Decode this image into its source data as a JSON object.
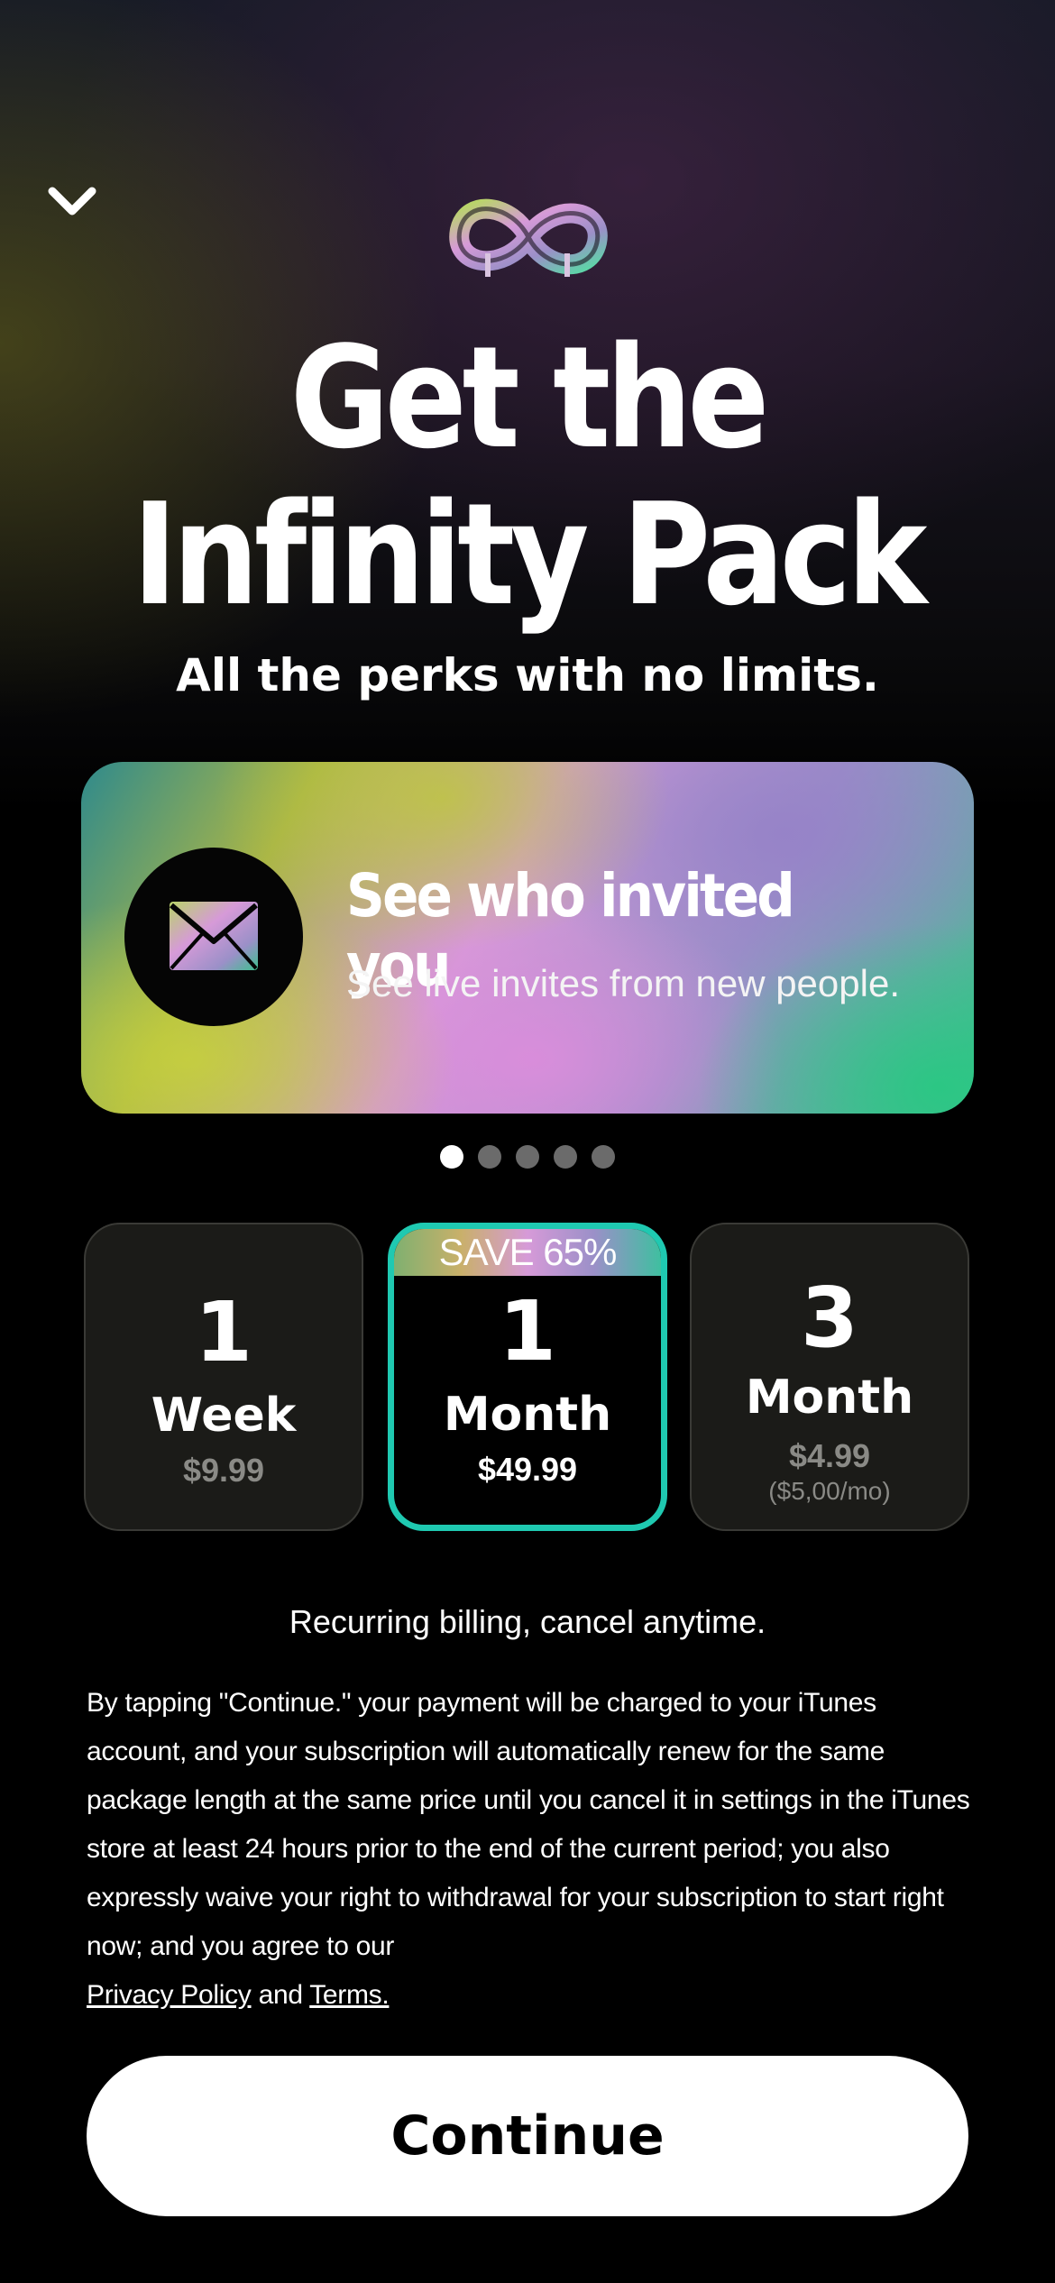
{
  "header": {
    "dismiss_icon": "chevron-down-icon",
    "logo_icon": "infinity-icon"
  },
  "hero": {
    "title_line1": "Get the",
    "title_line2": "Infinity Pack",
    "subtitle": "All the perks with no limits."
  },
  "feature_carousel": {
    "active_index": 0,
    "page_count": 5,
    "card": {
      "icon": "envelope-icon",
      "title": "See who invited you",
      "subtitle": "See live invites from new people."
    }
  },
  "plans": [
    {
      "number": "1",
      "unit": "Week",
      "price": "$9.99",
      "selected": false
    },
    {
      "badge": "SAVE 65%",
      "number": "1",
      "unit": "Month",
      "price": "$49.99",
      "selected": true
    },
    {
      "number": "3",
      "unit": "Month",
      "price": "$4.99",
      "per_month": "($5,00/mo)",
      "selected": false
    }
  ],
  "billing_note": "Recurring billing, cancel anytime.",
  "legal": {
    "text": "By tapping \"Continue.\" your payment will be charged to your iTunes account, and your subscription will automatically renew for the same package length at the same price until you cancel it in settings in the iTunes store at least 24 hours prior to the end of the current period; you also expressly waive your right to withdrawal for your subscription to start right now; and you agree to our",
    "privacy_link": "Privacy Policy",
    "and": "and",
    "terms_link": "Terms."
  },
  "cta": {
    "label": "Continue"
  },
  "colors": {
    "accent_teal": "#1fc9b1",
    "background": "#000000",
    "button_bg": "#ffffff"
  }
}
